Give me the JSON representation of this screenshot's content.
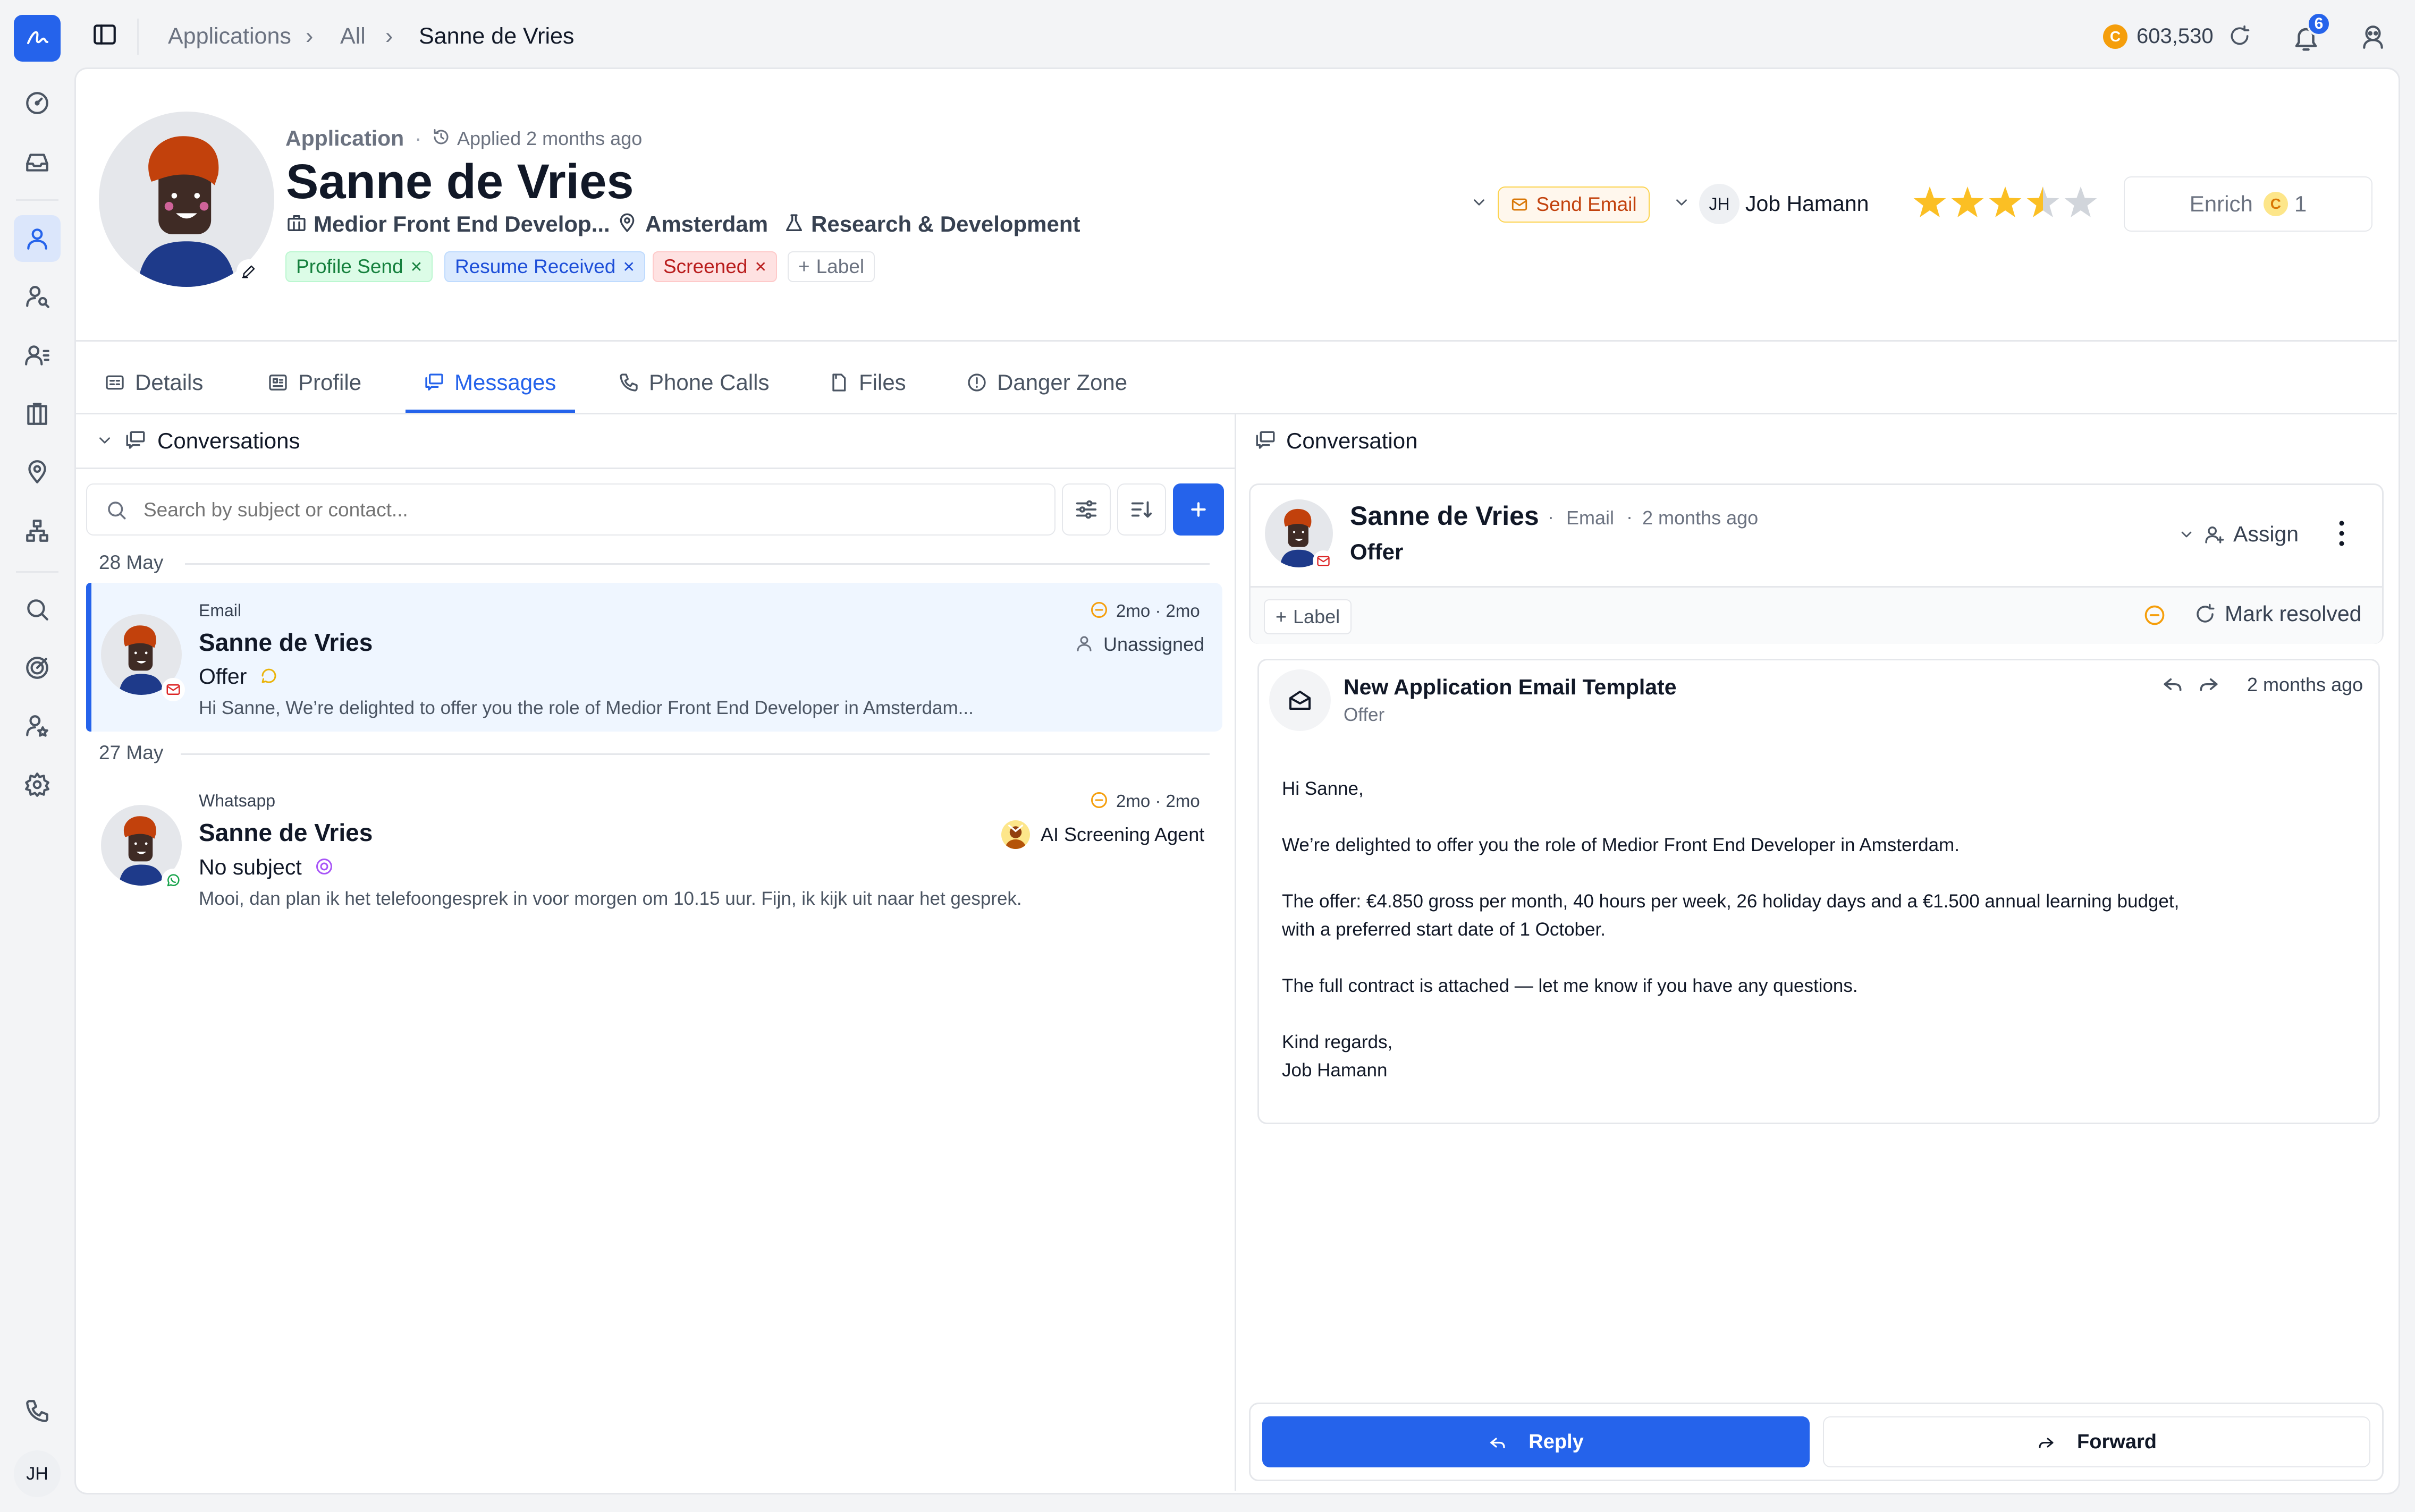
{
  "topbar": {
    "breadcrumbs": [
      "Applications",
      "All",
      "Sanne de Vries"
    ],
    "credits": "603,530",
    "notification_count": "6"
  },
  "rail": {
    "user_initials": "JH"
  },
  "header": {
    "type_label": "Application",
    "applied": "Applied 2 months ago",
    "name": "Sanne de Vries",
    "job": "Medior Front End Develop...",
    "location": "Amsterdam",
    "department": "Research & Development",
    "tags": [
      {
        "label": "Profile Send",
        "color": "#15803d",
        "bg": "#dcfce7"
      },
      {
        "label": "Resume Received",
        "color": "#1d4ed8",
        "bg": "#dbeafe"
      },
      {
        "label": "Screened",
        "color": "#b91c1c",
        "bg": "#fee2e2"
      }
    ],
    "add_label": "Label",
    "send_email": "Send Email",
    "owner_initials": "JH",
    "owner_name": "Job Hamann",
    "rating": 3.5,
    "enrich_label": "Enrich",
    "enrich_cost": "1"
  },
  "tabs": [
    {
      "label": "Details",
      "icon": "id-card-icon"
    },
    {
      "label": "Profile",
      "icon": "profile-card-icon"
    },
    {
      "label": "Messages",
      "icon": "chat-icon",
      "active": true
    },
    {
      "label": "Phone Calls",
      "icon": "phone-icon"
    },
    {
      "label": "Files",
      "icon": "file-icon"
    },
    {
      "label": "Danger Zone",
      "icon": "warning-icon"
    }
  ],
  "conversations": {
    "title": "Conversations",
    "search_placeholder": "Search by subject or contact...",
    "groups": [
      {
        "date": "28 May",
        "items": [
          {
            "channel": "Email",
            "name": "Sanne de Vries",
            "subject": "Offer",
            "time": "2mo · 2mo",
            "assignee": "Unassigned",
            "preview": "Hi Sanne, We’re delighted to offer you the role of Medior Front End Developer in Amsterdam..."
          }
        ]
      },
      {
        "date": "27 May",
        "items": [
          {
            "channel": "Whatsapp",
            "name": "Sanne de Vries",
            "subject": "No subject",
            "time": "2mo · 2mo",
            "assignee": "AI Screening Agent",
            "preview": "Mooi, dan plan ik het telefoongesprek in voor morgen om 10.15 uur. Fijn, ik kijk uit naar het gesprek."
          }
        ]
      }
    ]
  },
  "conversation": {
    "title": "Conversation",
    "contact_name": "Sanne de Vries",
    "channel": "Email",
    "time": "2 months ago",
    "subject": "Offer",
    "assign": "Assign",
    "add_label": "Label",
    "mark_resolved": "Mark resolved",
    "message": {
      "template": "New Application Email Template",
      "subject": "Offer",
      "time": "2 months ago",
      "body": [
        "Hi Sanne,",
        "We’re delighted to offer you the role of Medior Front End Developer in Amsterdam.",
        "The offer: €4.850 gross per month, 40 hours per week, 26 holiday days and a €1.500 annual learning budget,",
        "with a preferred start date of 1 October.",
        "The full contract is attached — let me know if you have any questions.",
        "Kind regards,",
        "Job Hamann"
      ]
    },
    "reply": "Reply",
    "forward": "Forward"
  },
  "colors": {
    "accent": "#2563eb",
    "amber": "#f59e0b"
  }
}
